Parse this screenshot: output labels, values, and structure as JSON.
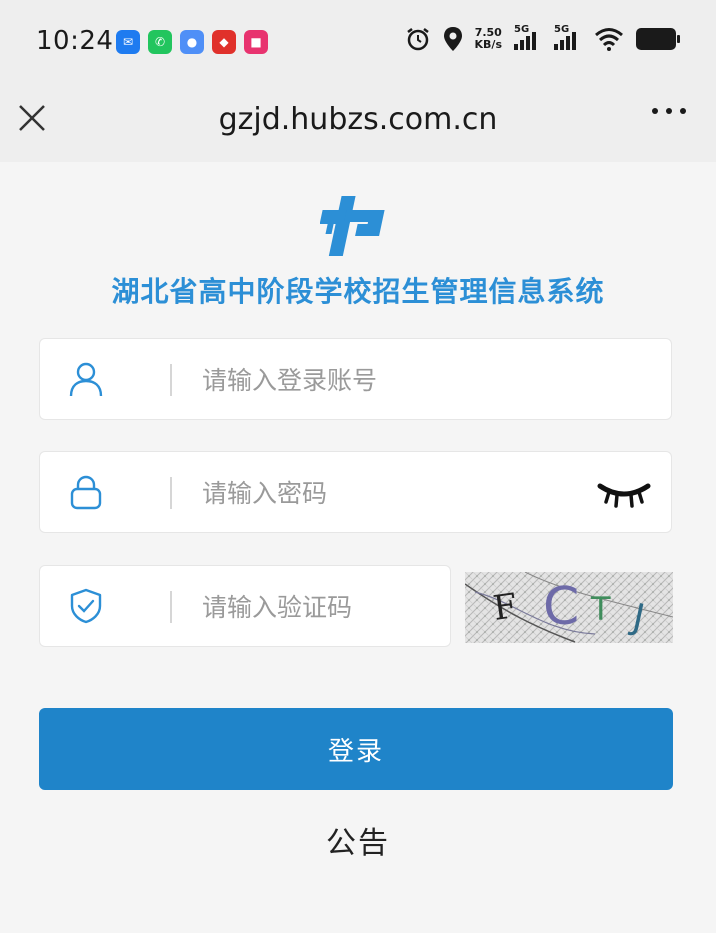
{
  "status_bar": {
    "time": "10:24",
    "net_speed_value": "7.50",
    "net_speed_unit": "KB/s",
    "signal_1": "5G",
    "signal_2": "5G",
    "app_icons": [
      "chat-app-icon",
      "phone-app-icon",
      "browser-app-icon",
      "bank-app-icon",
      "shop-app-icon"
    ]
  },
  "browser": {
    "url": "gzjd.hubzs.com.cn"
  },
  "page": {
    "title": "湖北省高中阶段学校招生管理信息系统",
    "accent_color": "#2c8fd6",
    "button_color": "#1f84c9",
    "account_placeholder": "请输入登录账号",
    "password_placeholder": "请输入密码",
    "captcha_placeholder": "请输入验证码",
    "captcha_text": "FCTJ",
    "login_label": "登录",
    "notice_label": "公告"
  }
}
